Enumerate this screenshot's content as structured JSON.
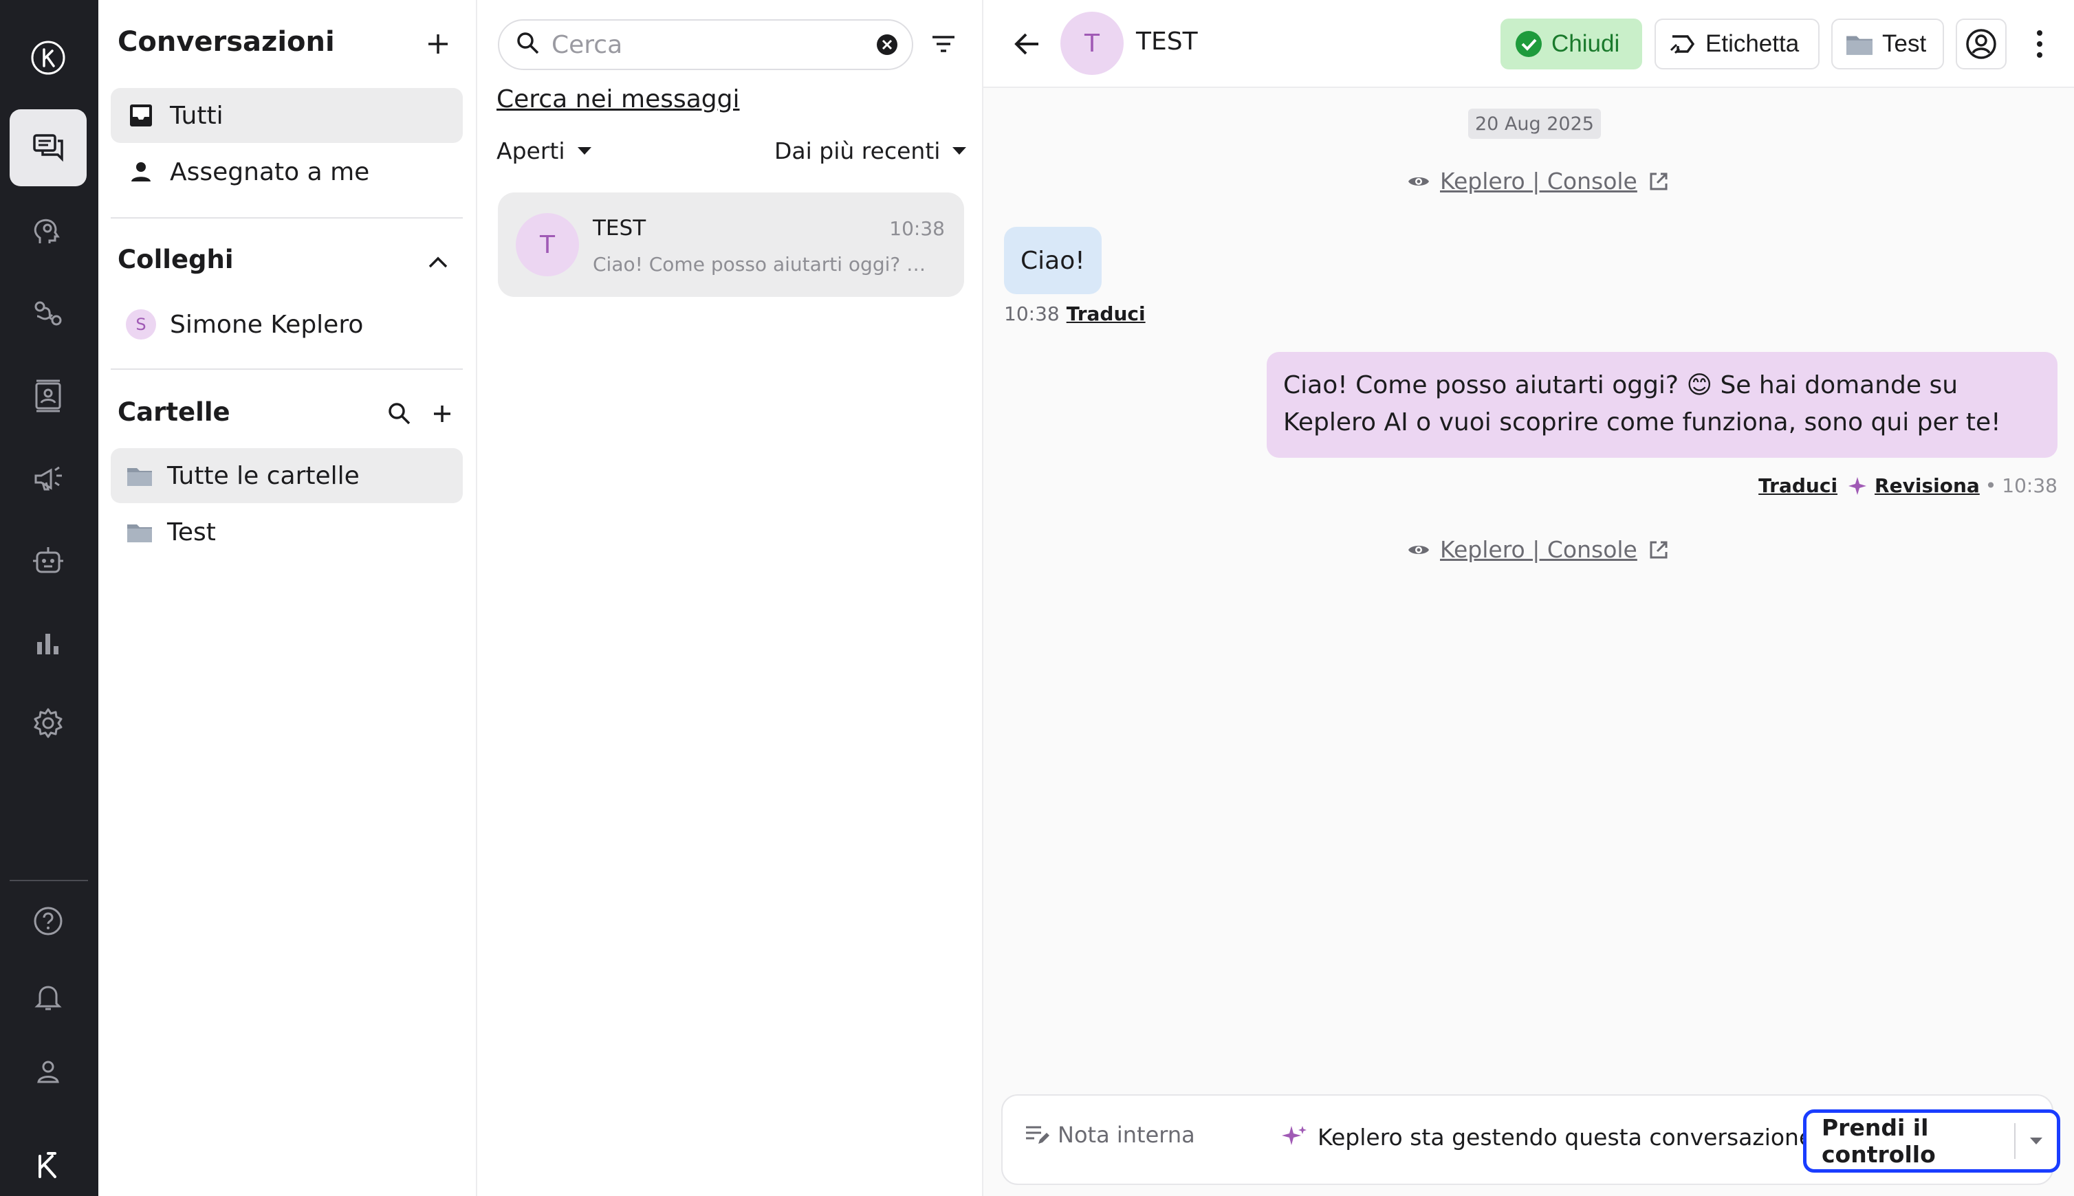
{
  "nav_rail": {
    "items": [
      "logo",
      "conversations",
      "ai-agent",
      "integrations",
      "contacts",
      "campaigns",
      "bots",
      "reports",
      "settings"
    ],
    "bottom_items": [
      "help",
      "notifications",
      "profile",
      "brand-logo"
    ]
  },
  "conversations_panel": {
    "title": "Conversazioni",
    "items": [
      {
        "label": "Tutti",
        "icon": "inbox-icon"
      },
      {
        "label": "Assegnato a me",
        "icon": "person-icon"
      }
    ],
    "colleagues_title": "Colleghi",
    "colleagues": [
      {
        "initial": "S",
        "name": "Simone Keplero"
      }
    ],
    "folders_title": "Cartelle",
    "folders": [
      {
        "label": "Tutte le cartelle"
      },
      {
        "label": "Test"
      }
    ]
  },
  "list_panel": {
    "search_placeholder": "Cerca",
    "search_messages_link": "Cerca nei messaggi",
    "status_filter": "Aperti",
    "sort_filter": "Dai più recenti",
    "conversations": [
      {
        "initial": "T",
        "name": "TEST",
        "time": "10:38",
        "preview": "Ciao! Come posso aiutarti oggi? 😊 Se hai domande su Keplero AI o vuoi scoprire come funziona, sono qui per te!"
      }
    ]
  },
  "chat": {
    "header": {
      "initial": "T",
      "name": "TEST",
      "close_label": "Chiudi",
      "label_label": "Etichetta",
      "folder_label": "Test"
    },
    "date": "20 Aug 2025",
    "source_label": "Keplero | Console",
    "messages": {
      "incoming_text": "Ciao!",
      "incoming_time": "10:38",
      "translate_label": "Traduci",
      "outgoing_text": "Ciao! Come posso aiutarti oggi? 😊 Se hai domande su Keplero AI o vuoi scoprire come funziona, sono qui per te!",
      "review_label": "Revisiona",
      "outgoing_time": "10:38",
      "dot": "•"
    },
    "composer": {
      "note_label": "Nota interna",
      "ai_status": "Keplero sta gestendo questa conversazione",
      "take_control_label": "Prendi il controllo"
    }
  },
  "colors": {
    "rail_bg": "#1e1f24",
    "accent_purple": "#ecd6f2",
    "incoming_bubble": "#d9e8f8",
    "close_green": "#c9efc9",
    "focus_blue": "#1a3dff"
  }
}
